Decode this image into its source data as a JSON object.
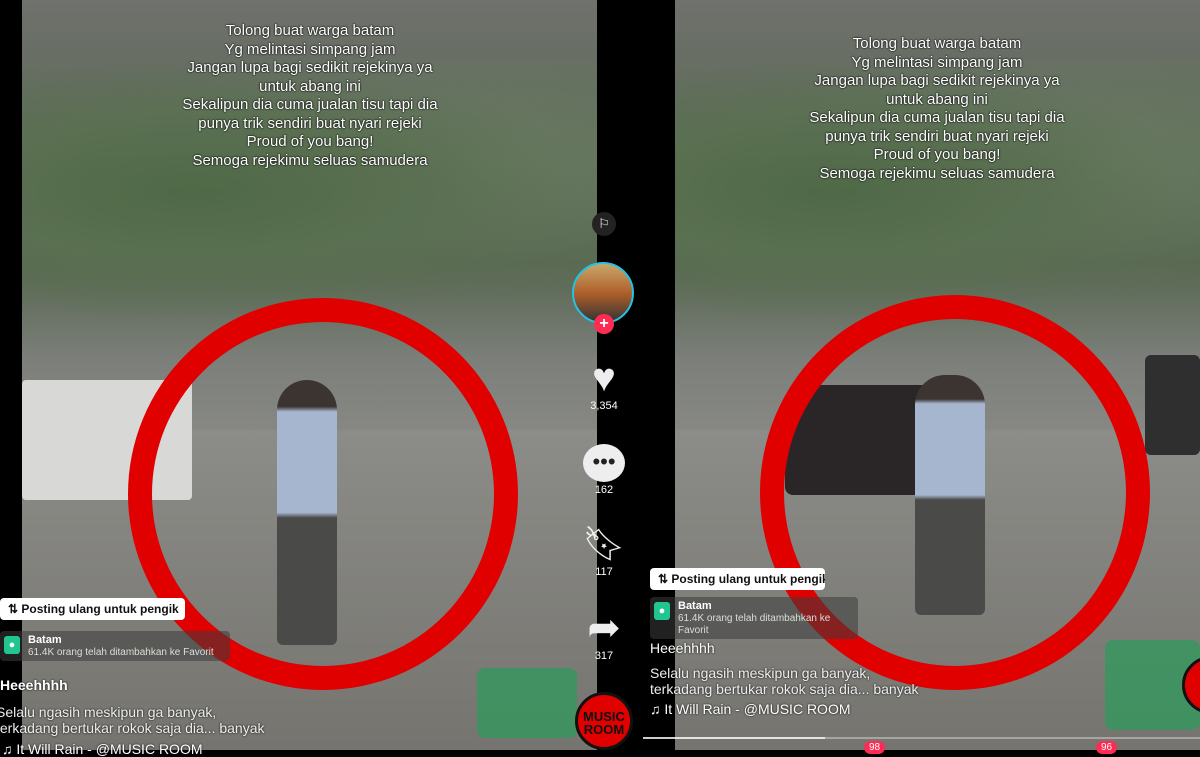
{
  "caption_lines": [
    "Tolong buat warga batam",
    "Yg melintasi simpang jam",
    "Jangan lupa bagi sedikit rejekinya ya",
    "untuk abang ini",
    "Sekalipun dia cuma jualan tisu tapi dia",
    "punya trik sendiri buat nyari rejeki",
    "Proud of you bang!",
    "Semoga rejekimu seluas samudera"
  ],
  "left": {
    "likes": "3,354",
    "comments": "162",
    "saves": "117",
    "shares": "317",
    "repost": "Posting ulang untuk pengik",
    "location": "Batam",
    "location_sub": "61.4K orang telah ditambahkan ke Favorit",
    "username": "Heeehhhh",
    "desc1": "Selalu ngasih meskipun ga banyak,",
    "desc2": "terkadang bertukar rokok saja dia... banyak",
    "music": "It Will Rain - @MUSIC ROOM"
  },
  "right": {
    "repost": "Posting ulang untuk pengikut",
    "location": "Batam",
    "location_sub": "61.4K orang telah ditambahkan ke Favorit",
    "username": "Heeehhhh",
    "desc1": "Selalu ngasih meskipun ga banyak,",
    "desc2": "terkadang bertukar rokok saja dia... banyak",
    "music": "It Will Rain - @MUSIC ROOM",
    "badge1": "98",
    "badge2": "96"
  },
  "logo": "MUSIC ROOM",
  "icons": {
    "flag": "flag-icon",
    "like": "heart-icon",
    "comment": "comment-icon",
    "save": "bookmark-icon",
    "share": "share-icon",
    "music": "music-note-icon",
    "location": "location-pin-icon",
    "repost": "repost-icon"
  },
  "colors": {
    "highlight_circle": "#e00000",
    "follow": "#fe2c55",
    "avatar_ring": "#22c3e6",
    "location_pin": "#20c58f"
  }
}
